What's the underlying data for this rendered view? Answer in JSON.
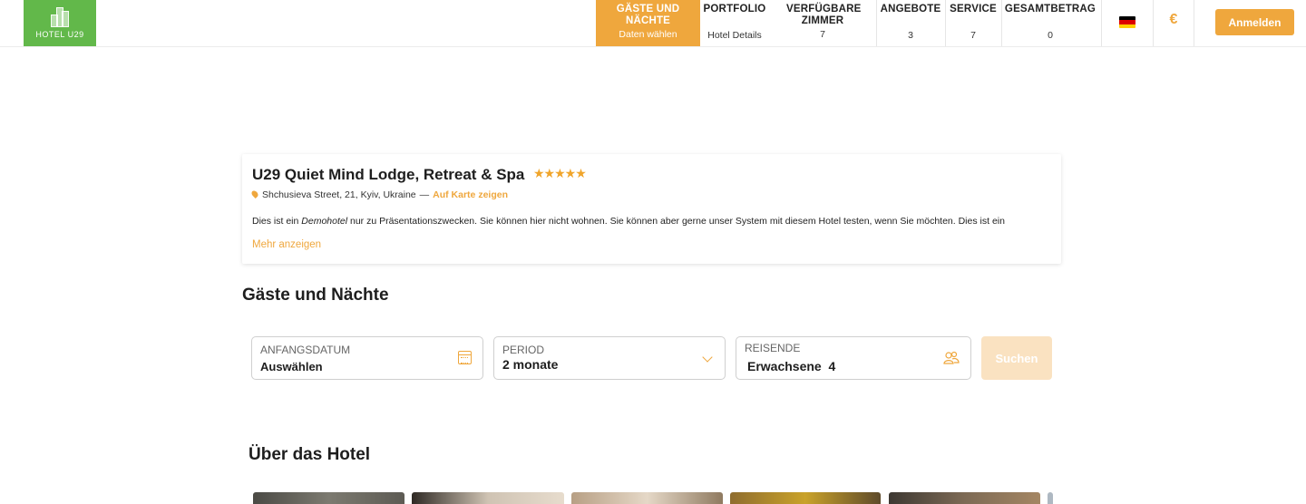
{
  "header": {
    "logo_text": "HOTEL U29",
    "nav": [
      {
        "title": "GÄSTE UND NÄCHTE",
        "sub": "Daten wählen",
        "active": true
      },
      {
        "title": "PORTFOLIO",
        "sub": "Hotel Details",
        "active": false
      },
      {
        "title": "VERFÜGBARE ZIMMER",
        "sub": "7",
        "active": false
      },
      {
        "title": "ANGEBOTE",
        "sub": "3",
        "active": false
      },
      {
        "title": "SERVICE",
        "sub": "7",
        "active": false
      },
      {
        "title": "GESAMTBETRAG",
        "sub": "0",
        "active": false
      }
    ],
    "language_icon": "german-flag-icon",
    "currency_symbol": "€",
    "login_label": "Anmelden"
  },
  "hotel": {
    "name": "U29 Quiet Mind Lodge, Retreat & Spa",
    "stars": "★★★★★",
    "address": "Shchusieva Street, 21, Kyiv, Ukraine",
    "map_link": "Auf Karte zeigen",
    "description_before": "Dies ist ein ",
    "description_em": "Demohotel",
    "description_after": " nur zu Präsentationszwecken. Sie können hier nicht wohnen. Sie können aber gerne unser System mit diesem Hotel testen, wenn Sie möchten. Dies ist ein",
    "more_label": "Mehr anzeigen"
  },
  "search": {
    "heading": "Gäste und Nächte",
    "start_label": "ANFANGSDATUM",
    "start_value": "Auswählen",
    "period_label": "PERIOD",
    "period_value": "2 monate",
    "travelers_label": "REISENDE",
    "travelers_value": "Erwachsene  4",
    "search_button": "Suchen"
  },
  "about": {
    "heading": "Über das Hotel"
  },
  "colors": {
    "accent": "#efa73d",
    "logo_green": "#62b84a",
    "search_disabled": "#fae2c1"
  }
}
